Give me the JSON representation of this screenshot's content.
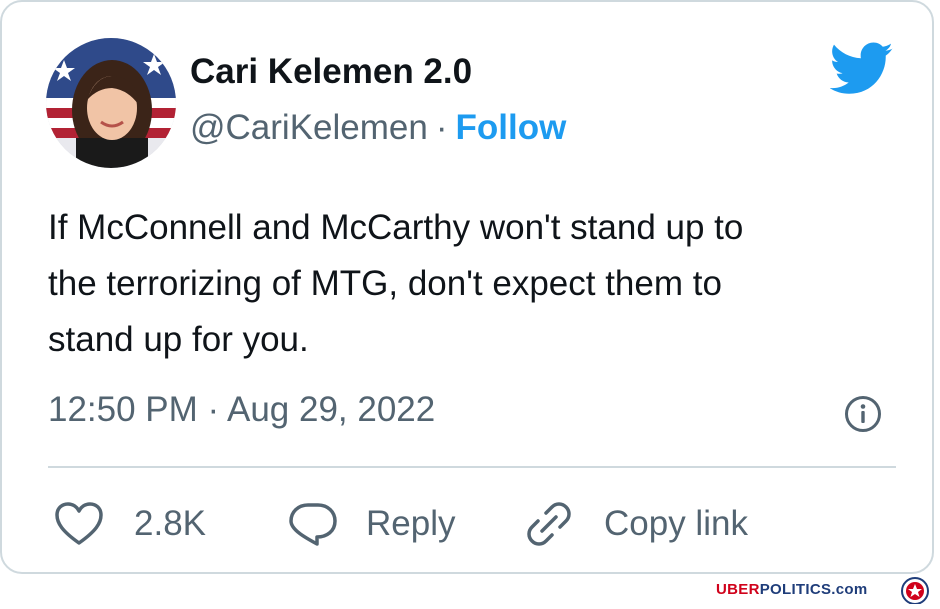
{
  "tweet": {
    "author_name": "Cari Kelemen 2.0",
    "handle": "@CariKelemen",
    "separator": "·",
    "follow_label": "Follow",
    "text_lines": [
      "If McConnell and McCarthy won't stand up to",
      "the terrorizing of MTG, don't expect them to",
      "stand up for you."
    ],
    "timestamp": "12:50 PM · Aug 29, 2022",
    "likes_count": "2.8K",
    "reply_label": "Reply",
    "copy_link_label": "Copy link"
  },
  "icons": {
    "brand": "twitter-bird-icon",
    "info": "info-icon",
    "like": "heart-icon",
    "reply": "speech-bubble-icon",
    "copy": "link-icon"
  },
  "colors": {
    "accent": "#1d9bf0",
    "text": "#0f1419",
    "muted": "#536471",
    "border": "#cfd9de",
    "watermark_red": "#d0021b",
    "watermark_blue": "#1f3d7a"
  },
  "watermark": {
    "part1": "UBER",
    "part2": "POLITICS",
    "part3": ".com"
  }
}
